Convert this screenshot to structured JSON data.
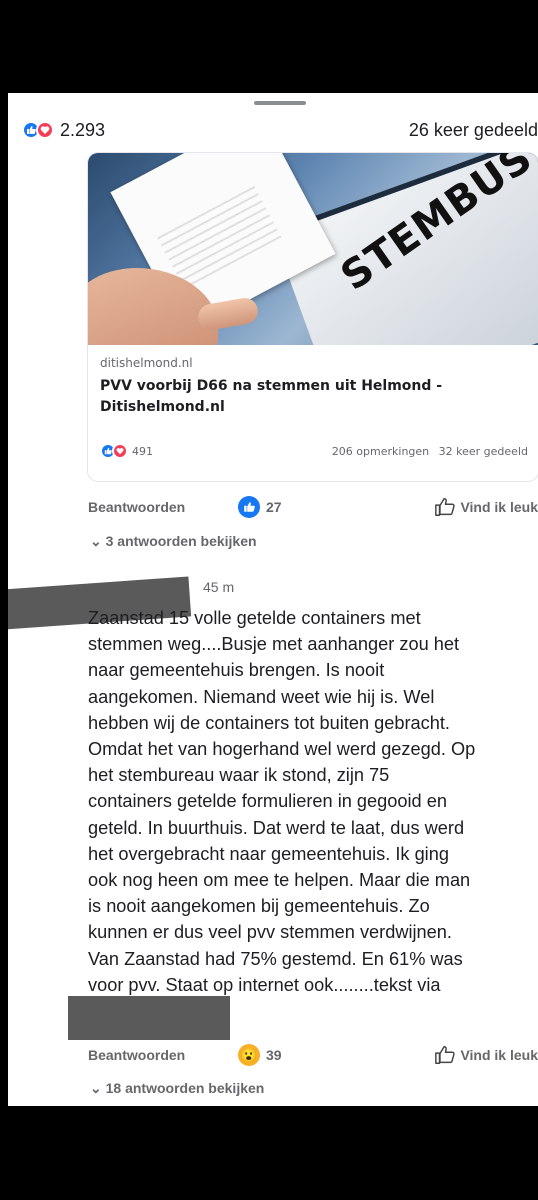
{
  "post": {
    "reaction_count": "2.293",
    "share_text": "26 keer gedeeld"
  },
  "link_card": {
    "image_text": "STEMBUS",
    "domain": "ditishelmond.nl",
    "title": "PVV voorbij D66 na stemmen uit Helmond - Ditishelmond.nl",
    "reaction_count": "491",
    "comments_text": "206 opmerkingen",
    "shares_text": "32 keer gedeeld"
  },
  "comment1_actions": {
    "reply_label": "Beantwoorden",
    "reaction_count": "27",
    "like_label": "Vind ik leuk",
    "view_replies": "3 antwoorden bekijken"
  },
  "comment2": {
    "time": "45 m",
    "text": "Zaanstad 15 volle getelde containers met\nstemmen weg....Busje met aanhanger zou het\nnaar gemeentehuis brengen. Is nooit\naangekomen. Niemand weet wie hij is. Wel\nhebben wij de containers tot buiten gebracht.\nOmdat het van hogerhand wel werd gezegd.  Op\nhet stembureau waar ik stond, zijn 75\ncontainers getelde formulieren in gegooid en\ngeteld. In buurthuis. Dat werd te laat, dus werd\nhet overgebracht naar gemeentehuis. Ik ging\nook nog heen om mee te helpen. Maar die man\nis nooit aangekomen bij gemeentehuis. Zo\nkunnen er dus veel pvv stemmen verdwijnen.\nVan Zaanstad had 75% gestemd. En 61% was\nvoor pvv. Staat op internet ook........tekst via",
    "reply_label": "Beantwoorden",
    "reaction_count": "39",
    "like_label": "Vind ik leuk",
    "view_replies": "18 antwoorden bekijken"
  },
  "colors": {
    "like_blue": "#1877f2",
    "love_red": "#f33e58",
    "wow_yellow": "#f7b125",
    "muted_text": "#65676b"
  }
}
